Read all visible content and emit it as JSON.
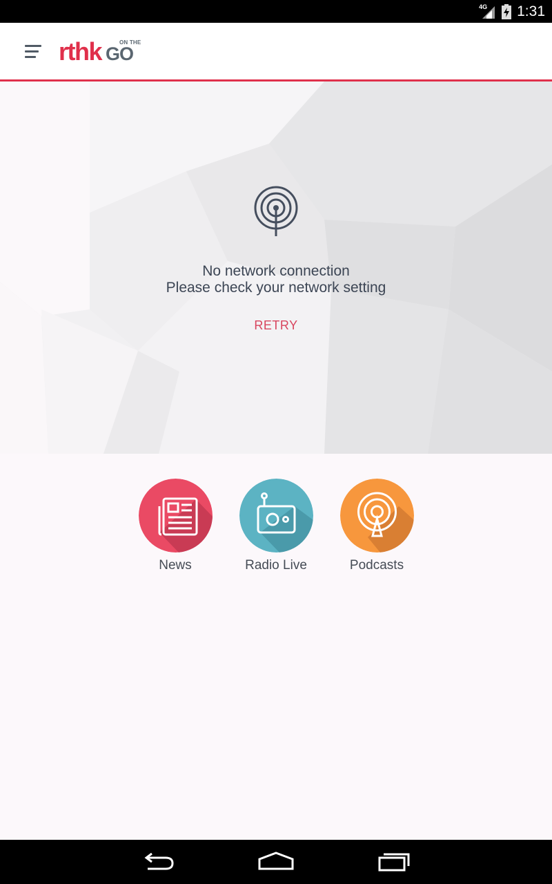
{
  "status_bar": {
    "network": "4G",
    "time": "1:31",
    "icons": [
      "signal-icon",
      "battery-icon"
    ]
  },
  "app_bar": {
    "logo_text": "rthk",
    "logo_suffix": "GO",
    "logo_tagline": "ON THE",
    "menu_icon": "hamburger-menu-icon",
    "accent_color": "#e0304b"
  },
  "error": {
    "icon": "broadcast-antenna-icon",
    "line1": "No network connection",
    "line2": "Please check your network setting",
    "retry_label": "RETRY"
  },
  "shortcuts": [
    {
      "label": "News",
      "icon": "newspaper-icon",
      "color": "#ea4a64"
    },
    {
      "label": "Radio Live",
      "icon": "radio-icon",
      "color": "#5cb3c3"
    },
    {
      "label": "Podcasts",
      "icon": "podcast-icon",
      "color": "#f7973d"
    }
  ],
  "nav_bar": {
    "icons": [
      "back-icon",
      "home-icon",
      "recent-apps-icon"
    ]
  }
}
